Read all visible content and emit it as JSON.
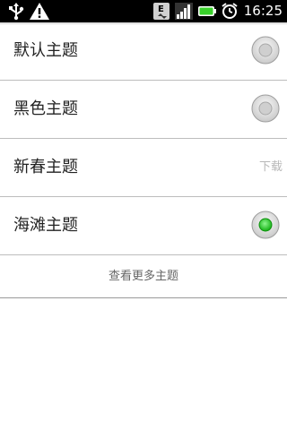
{
  "status_bar": {
    "time": "16:25",
    "left_icons": [
      "usb-icon",
      "warning-icon"
    ],
    "right_icons": [
      "edge-data-icon",
      "signal-icon",
      "battery-icon",
      "alarm-icon"
    ]
  },
  "themes": {
    "items": [
      {
        "label": "默认主题",
        "control": "radio",
        "selected": false
      },
      {
        "label": "黑色主题",
        "control": "radio",
        "selected": false
      },
      {
        "label": "新春主题",
        "control": "download",
        "action_label": "下载"
      },
      {
        "label": "海滩主题",
        "control": "radio",
        "selected": true
      }
    ],
    "more_label": "查看更多主题"
  },
  "colors": {
    "selected_dot": "#22cc22",
    "status_bar_bg": "#000000",
    "battery": "#39d12b"
  }
}
